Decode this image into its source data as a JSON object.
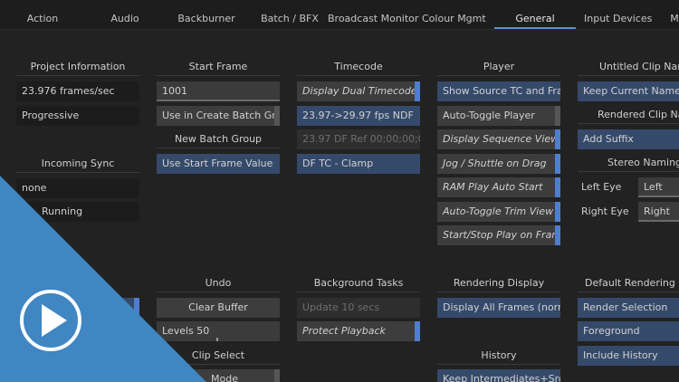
{
  "tabs": [
    "Action",
    "Audio",
    "Backburner",
    "Batch / BFX",
    "Broadcast Monitor",
    "Colour Mgmt",
    "General",
    "Input Devices",
    "M"
  ],
  "project": {
    "header": "Project Information",
    "frame_rate": "23.976 frames/sec",
    "scan": "Progressive"
  },
  "incoming_sync": {
    "header": "Incoming Sync",
    "value": "none",
    "status": "Running"
  },
  "start_frame": {
    "header": "Start Frame",
    "value": "1001",
    "button": "Use in Create Batch Group"
  },
  "new_batch_group": {
    "header": "New Batch Group",
    "button": "Use Start Frame Value"
  },
  "timecode": {
    "header": "Timecode",
    "dual": "Display Dual Timecodes",
    "conversion": "23.97->29.97 fps NDF",
    "ref": "23.97 DF Ref 00;00;00;00",
    "clamp": "DF TC - Clamp"
  },
  "player": {
    "header": "Player",
    "items": [
      "Show Source TC and Frame",
      "Auto-Toggle Player",
      "Display Sequence Viewer",
      "Jog / Shuttle on Drag",
      "RAM Play Auto Start",
      "Auto-Toggle Trim View",
      "Start/Stop Play on Frame"
    ]
  },
  "untitled_clip": {
    "header": "Untitled Clip Name",
    "value": "Keep Current Name"
  },
  "rendered_clip": {
    "header": "Rendered Clip Name",
    "value": "Add Suffix"
  },
  "stereo": {
    "header": "Stereo Naming",
    "left_label": "Left Eye",
    "left_value": "Left",
    "right_label": "Right Eye",
    "right_value": "Right"
  },
  "undo": {
    "header": "Undo",
    "clear": "Clear Buffer",
    "levels": "Levels 50"
  },
  "clip_select": {
    "header": "Clip Select",
    "mode": "Mode"
  },
  "background_tasks": {
    "header": "Background Tasks",
    "update": "Update 10 secs",
    "protect": "Protect Playback"
  },
  "rendering_display": {
    "header": "Rendering Display",
    "value": "Display All Frames (normal)"
  },
  "history": {
    "header": "History",
    "value": "Keep Intermediates+Src"
  },
  "default_rendering": {
    "header": "Default Rendering Options",
    "selection": "Render Selection",
    "foreground": "Foreground",
    "history": "Include History"
  },
  "colors": {
    "accent_blue": "#4d7ecf",
    "overlay_blue": "#3f86c2"
  },
  "icons": {
    "play": "play-icon"
  }
}
